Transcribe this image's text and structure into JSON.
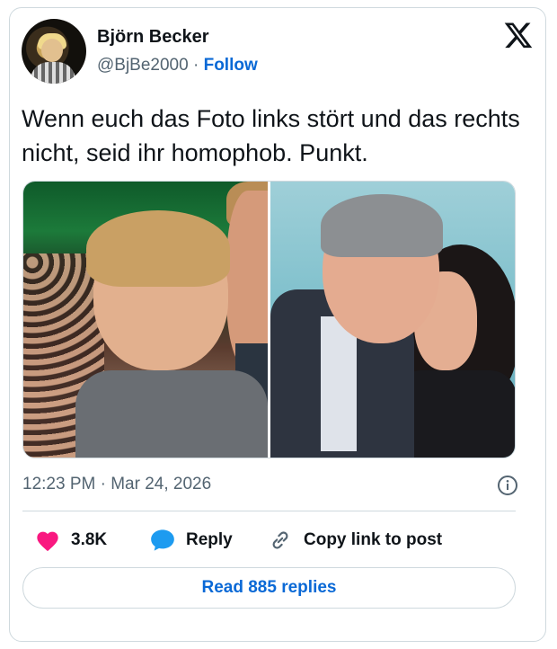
{
  "author": {
    "name": "Björn Becker",
    "handle": "@BjBe2000",
    "separator": "·",
    "follow_label": "Follow",
    "avatar_icon": "profile-photo"
  },
  "platform_icon": "x-logo-icon",
  "tweet": {
    "text": "Wenn euch das Foto links stört und das rechts nicht, seid ihr homophob. Punkt."
  },
  "media": {
    "left_photo": "couple-kissing-photo-left",
    "right_photo": "couple-kissing-photo-right"
  },
  "meta": {
    "timestamp": "12:23 PM · Mar 24, 2026",
    "info_icon": "info-icon"
  },
  "actions": {
    "like_count": "3.8K",
    "reply_label": "Reply",
    "copy_link_label": "Copy link to post"
  },
  "read_replies_label": "Read 885 replies",
  "colors": {
    "link_blue": "#0a69d6",
    "like_pink": "#f91880",
    "reply_blue": "#1d9bf0",
    "border": "#cfd9de",
    "muted": "#536471"
  }
}
